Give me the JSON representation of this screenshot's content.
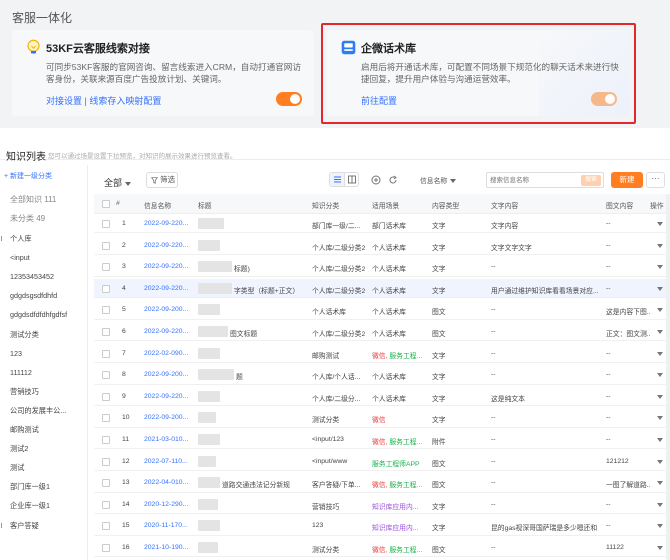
{
  "top": {
    "section_title": "客服一体化",
    "card1": {
      "title": "53KF云客服线索对接",
      "desc": "可同步53KF客服的官网咨询、留言线索进入CRM，自动打通官网访客身份，关联来源百度广告投放计划、关键词。",
      "links": "对接设置 | 线索存入映射配置",
      "toggle_on": true
    },
    "card2": {
      "title": "企微话术库",
      "desc": "启用后将开通话术库，可配置不同场景下规范化的聊天话术来进行快捷回复，提升用户体验与沟通运营效率。",
      "link": "前往配置",
      "toggle_on": true
    },
    "accent": "#ff7e21",
    "highlight_color": "#e3272d"
  },
  "knowledge": {
    "title": "知识列表",
    "subtitle": "您可以通过场景设置下拉预览，对知识的展示效果进行预览查看。",
    "sidebar": {
      "new_category": "+ 新建一级分类",
      "all": "全部知识 111",
      "uncategorized": "未分类 49",
      "items": [
        "个人库",
        "<input",
        "12353453452",
        "gdgdsgsdfdhfd",
        "gdgdsdfdfdhfgdfsf",
        "测试分类",
        "123",
        "111112",
        "营销技巧",
        "公司的发展丰公...",
        "邮购测试",
        "测试2",
        "测试",
        "部门库一级1",
        "企业库一级1",
        "客户答疑"
      ]
    },
    "toolbar": {
      "scope": "全部",
      "filter": "筛选",
      "field": "信息名称",
      "search_placeholder": "搜索信息名称",
      "search_btn": "搜索",
      "new_btn": "新建",
      "more": "···"
    },
    "columns": [
      "#",
      "信息名称",
      "标题",
      "知识分类",
      "适用场景",
      "内容类型",
      "文字内容",
      "图文内容",
      "操作"
    ],
    "rows": [
      {
        "no": "1",
        "date": "2022-09-220...",
        "title": "",
        "cat": "部门库一级/二...",
        "scene": "部门话术库",
        "scene_c": "",
        "type": "文字",
        "text": "文字内容",
        "img": "--"
      },
      {
        "no": "2",
        "date": "2022-09-220...",
        "title": "",
        "cat": "个人库/二级分类2",
        "scene": "个人话术库",
        "scene_c": "",
        "type": "文字",
        "text": "文字文字文字",
        "img": "--"
      },
      {
        "no": "3",
        "date": "2022-09-220...",
        "title": "标题)",
        "cat": "个人库/二级分类2",
        "scene": "个人话术库",
        "scene_c": "",
        "type": "文字",
        "text": "--",
        "img": "--"
      },
      {
        "no": "4",
        "date": "2022-09-220...",
        "title": "字类型（标题+正文）",
        "cat": "个人库/二级分类2",
        "scene": "个人话术库",
        "scene_c": "",
        "type": "文字",
        "text": "用户通过维护知识库看看场景对应...",
        "img": "--"
      },
      {
        "no": "5",
        "date": "2022-09-200...",
        "title": "",
        "cat": "个人话术库",
        "scene": "个人话术库",
        "scene_c": "",
        "type": "图文",
        "text": "--",
        "img": "这是内容下图..."
      },
      {
        "no": "6",
        "date": "2022-09-220...",
        "title": "图文标题",
        "cat": "个人库/二级分类2",
        "scene": "个人话术库",
        "scene_c": "",
        "type": "图文",
        "text": "--",
        "img": "正文：图文测..."
      },
      {
        "no": "7",
        "date": "2022-02-090...",
        "title": "",
        "cat": "邮购测试",
        "scene": "微信, 服务工程...",
        "scene_c": "mix",
        "type": "文字",
        "text": "--",
        "img": "--"
      },
      {
        "no": "8",
        "date": "2022-09-200...",
        "title": "题",
        "cat": "个人库/个人话...",
        "scene": "个人话术库",
        "scene_c": "",
        "type": "文字",
        "text": "--",
        "img": "--"
      },
      {
        "no": "9",
        "date": "2022-09-220...",
        "title": "",
        "cat": "个人库/二级分...",
        "scene": "个人话术库",
        "scene_c": "",
        "type": "文字",
        "text": "这是纯文本",
        "img": "--"
      },
      {
        "no": "10",
        "date": "2022-09-200...",
        "title": "",
        "cat": "测试分类",
        "scene": "微信",
        "scene_c": "red",
        "type": "文字",
        "text": "--",
        "img": "--"
      },
      {
        "no": "11",
        "date": "2021-03-010...",
        "title": "",
        "cat": "<input/123",
        "scene": "微信, 服务工程...",
        "scene_c": "mix",
        "type": "附件",
        "text": "--",
        "img": "--"
      },
      {
        "no": "12",
        "date": "2022-07-110...",
        "title": "",
        "cat": "<input/www",
        "scene": "服务工程师APP",
        "scene_c": "green",
        "type": "图文",
        "text": "--",
        "img": "121212"
      },
      {
        "no": "13",
        "date": "2022-04-010...",
        "title": "道路交通违法记分新规",
        "cat": "客户答疑/下单...",
        "scene": "微信, 服务工程...",
        "scene_c": "mix",
        "type": "图文",
        "text": "--",
        "img": "一图了解道路..."
      },
      {
        "no": "14",
        "date": "2020-12-290...",
        "title": "",
        "cat": "营销技巧",
        "scene": "知识库应用内...",
        "scene_c": "purple",
        "type": "文字",
        "text": "--",
        "img": "--"
      },
      {
        "no": "15",
        "date": "2020-11-170...",
        "title": "",
        "cat": "123",
        "scene": "知识库应用内...",
        "scene_c": "purple",
        "type": "文字",
        "text": "昆的gas视深哥国萨瑞是多少嗯还和",
        "img": "--"
      },
      {
        "no": "16",
        "date": "2021-10-190...",
        "title": "",
        "cat": "测试分类",
        "scene": "微信, 服务工程...",
        "scene_c": "mix",
        "type": "图文",
        "text": "--",
        "img": "11122"
      }
    ]
  }
}
